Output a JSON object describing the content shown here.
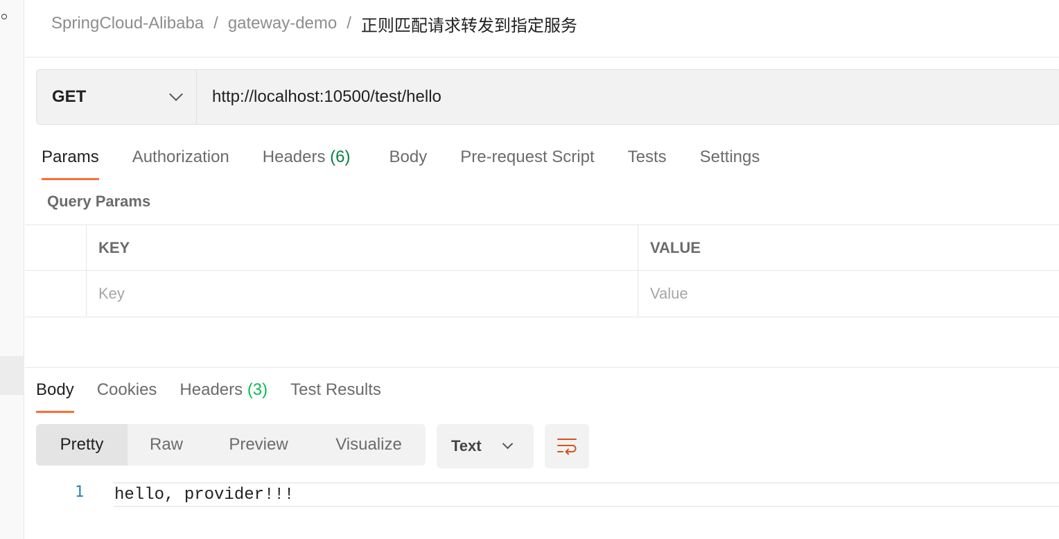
{
  "breadcrumb": {
    "items": [
      "SpringCloud-Alibaba",
      "gateway-demo"
    ],
    "separator": "/",
    "current": "正则匹配请求转发到指定服务"
  },
  "request": {
    "method": "GET",
    "url": "http://localhost:10500/test/hello"
  },
  "request_tabs": [
    {
      "label": "Params",
      "active": true
    },
    {
      "label": "Authorization"
    },
    {
      "label": "Headers",
      "count": "(6)"
    },
    {
      "label": "Body"
    },
    {
      "label": "Pre-request Script"
    },
    {
      "label": "Tests"
    },
    {
      "label": "Settings"
    }
  ],
  "query_params": {
    "title": "Query Params",
    "headers": {
      "key": "KEY",
      "value": "VALUE"
    },
    "placeholders": {
      "key": "Key",
      "value": "Value"
    }
  },
  "response_tabs": [
    {
      "label": "Body",
      "active": true
    },
    {
      "label": "Cookies"
    },
    {
      "label": "Headers",
      "count": "(3)"
    },
    {
      "label": "Test Results"
    }
  ],
  "view_modes": [
    "Pretty",
    "Raw",
    "Preview",
    "Visualize"
  ],
  "active_view_mode": "Pretty",
  "format": "Text",
  "icons": {
    "wrap": "wrap-lines-icon",
    "dropdown": "chevron-down-icon"
  },
  "colors": {
    "accent": "#ff6c37",
    "count_request": "#0a8043",
    "count_response": "#0cbb52",
    "wrap_icon": "#d6511e"
  },
  "response_body": {
    "lines": [
      {
        "number": "1",
        "text": "hello, provider!!!"
      }
    ]
  }
}
